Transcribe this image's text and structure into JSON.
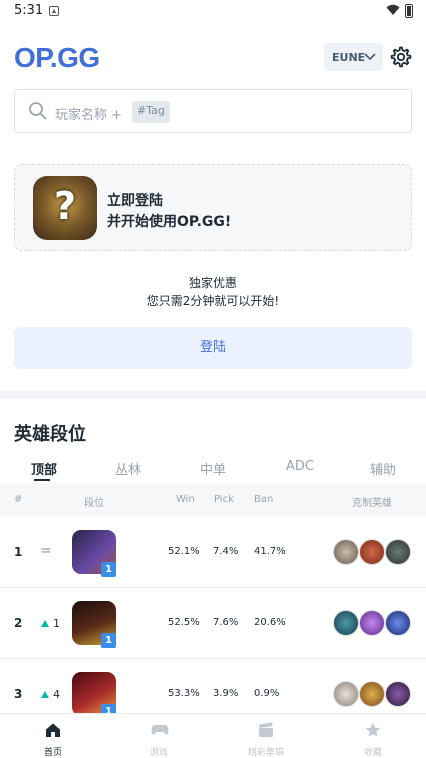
{
  "status_bar": {
    "time": "5:31"
  },
  "header": {
    "logo": "OP.GG",
    "region": "EUNE"
  },
  "search": {
    "placeholder": "玩家名称 +",
    "tag": "#Tag"
  },
  "login_card": {
    "line1": "立即登陆",
    "line2": "并开始使用OP.GG!"
  },
  "promo": {
    "line1": "独家优惠",
    "line2": "您只需2分钟就可以开始!"
  },
  "login_button": "登陆",
  "section_title": "英雄段位",
  "tabs": [
    "顶部",
    "丛林",
    "中单",
    "ADC",
    "辅助"
  ],
  "active_tab": 0,
  "table_header": {
    "rank": "#",
    "tier": "段位",
    "win": "Win",
    "pick": "Pick",
    "ban": "Ban",
    "counters": "克制英雄"
  },
  "rows": [
    {
      "rank": "1",
      "change": "=",
      "change_type": "same",
      "tier": "1",
      "win": "52.1%",
      "pick": "7.4%",
      "ban": "41.7%",
      "champ_color": "#4b3a8a",
      "counter_colors": [
        "#9b8c7a",
        "#b44a32",
        "#4a5a56"
      ]
    },
    {
      "rank": "2",
      "change": "1",
      "change_type": "up",
      "tier": "1",
      "win": "52.5%",
      "pick": "7.6%",
      "ban": "20.6%",
      "champ_color": "#3a2018",
      "counter_colors": [
        "#2d6a7a",
        "#8a48c8",
        "#3050a8"
      ]
    },
    {
      "rank": "3",
      "change": "4",
      "change_type": "up",
      "tier": "1",
      "win": "53.3%",
      "pick": "3.9%",
      "ban": "0.9%",
      "champ_color": "#8a1a22",
      "counter_colors": [
        "#c8c0b8",
        "#c89040",
        "#5a3a6a"
      ]
    }
  ],
  "bottom_nav": [
    {
      "label": "首页",
      "icon": "home-icon",
      "active": true
    },
    {
      "label": "游戏",
      "icon": "gamepad-icon",
      "active": false
    },
    {
      "label": "精彩集锦",
      "icon": "clapperboard-icon",
      "active": false
    },
    {
      "label": "收藏",
      "icon": "star-icon",
      "active": false
    }
  ],
  "colors": {
    "brand": "#4171d6",
    "up_arrow": "#00bba3",
    "tier_badge": "#3a8ee6"
  }
}
